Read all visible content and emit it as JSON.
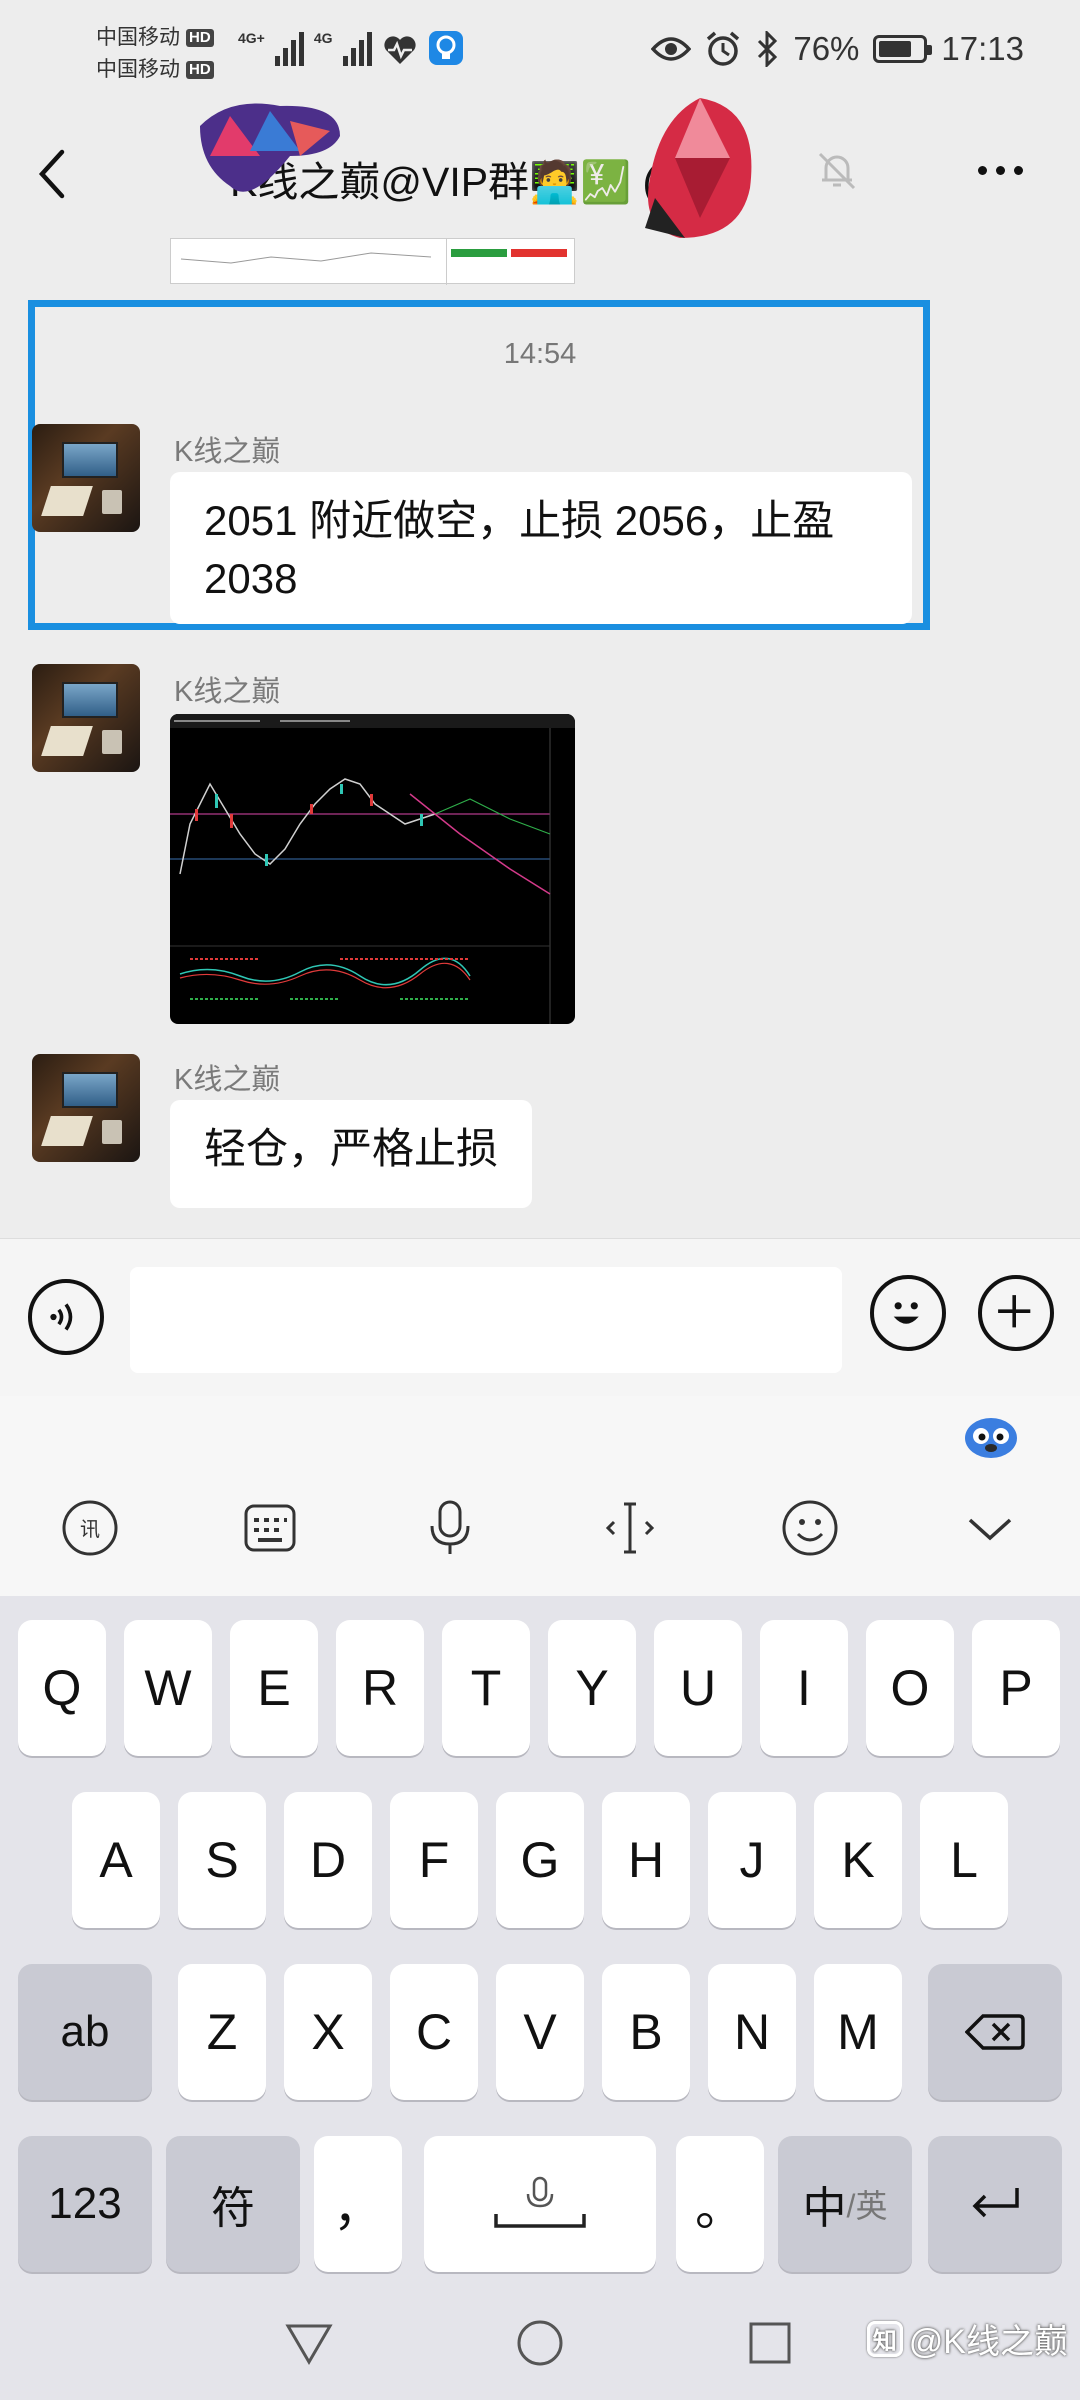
{
  "status_bar": {
    "carrier_1": "中国移动",
    "carrier_2": "中国移动",
    "hd_badge": "HD",
    "net_1": "4G+",
    "net_2": "4G",
    "battery_percent": "76%",
    "battery_level": 0.76,
    "time": "17:13"
  },
  "title_bar": {
    "title": "K线之巅@VIP群🧑‍💻💹 (8)",
    "icons": [
      "back-arrow",
      "mute-bell",
      "more-dots"
    ]
  },
  "chat": {
    "timestamp": "14:54",
    "messages": [
      {
        "sender": "K线之巅",
        "type": "text",
        "text": "2051 附近做空，止损 2056，止盈 2038"
      },
      {
        "sender": "K线之巅",
        "type": "image",
        "alt": "trading chart screenshot"
      },
      {
        "sender": "K线之巅",
        "type": "text",
        "text": "轻仓，严格止损"
      }
    ]
  },
  "input_bar": {
    "placeholder": "",
    "icons": [
      "voice-icon",
      "emoji-icon",
      "plus-icon"
    ]
  },
  "keyboard": {
    "toolbar": [
      "handwriting-icon",
      "keyboard-icon",
      "mic-icon",
      "cursor-icon",
      "emoji-icon",
      "collapse-icon"
    ],
    "row1": [
      "Q",
      "W",
      "E",
      "R",
      "T",
      "Y",
      "U",
      "I",
      "O",
      "P"
    ],
    "row2": [
      "A",
      "S",
      "D",
      "F",
      "G",
      "H",
      "J",
      "K",
      "L"
    ],
    "row3": [
      "Z",
      "X",
      "C",
      "V",
      "B",
      "N",
      "M"
    ],
    "shift_label": "ab",
    "num_label": "123",
    "symbol_label": "符",
    "comma_label": "，",
    "period_label": "。",
    "lang_main": "中",
    "lang_sub": "/英"
  },
  "watermark": "@K线之巅",
  "watermark_logo": "知",
  "colors": {
    "highlight": "#1a8fe0",
    "bubble": "#ffffff",
    "background": "#ededed"
  }
}
